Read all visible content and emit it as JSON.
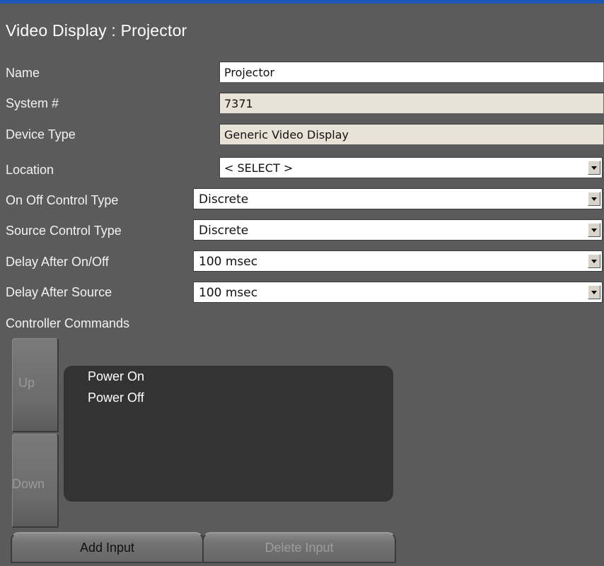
{
  "header": {
    "title": "Video Display : Projector"
  },
  "form": {
    "name": {
      "label": "Name",
      "value": "Projector"
    },
    "system": {
      "label": "System #",
      "value": "7371"
    },
    "device_type": {
      "label": "Device Type",
      "value": "Generic Video Display"
    },
    "location": {
      "label": "Location",
      "value": "< SELECT >"
    },
    "on_off_control": {
      "label": "On Off Control Type",
      "value": "Discrete"
    },
    "source_control": {
      "label": "Source Control Type",
      "value": "Discrete"
    },
    "delay_on_off": {
      "label": "Delay After On/Off",
      "value": "100 msec"
    },
    "delay_source": {
      "label": "Delay After Source",
      "value": "100 msec"
    }
  },
  "commands": {
    "label": "Controller Commands",
    "up_label": "Up",
    "down_label": "Down",
    "items": [
      "Power On",
      "Power Off"
    ]
  },
  "actions": {
    "add_input": "Add Input",
    "delete_input": "Delete Input"
  },
  "colors": {
    "background": "#5b5b5b",
    "accent_bar": "#1f57b8",
    "list_background": "#333333",
    "readonly_field": "#e8e3d6"
  }
}
